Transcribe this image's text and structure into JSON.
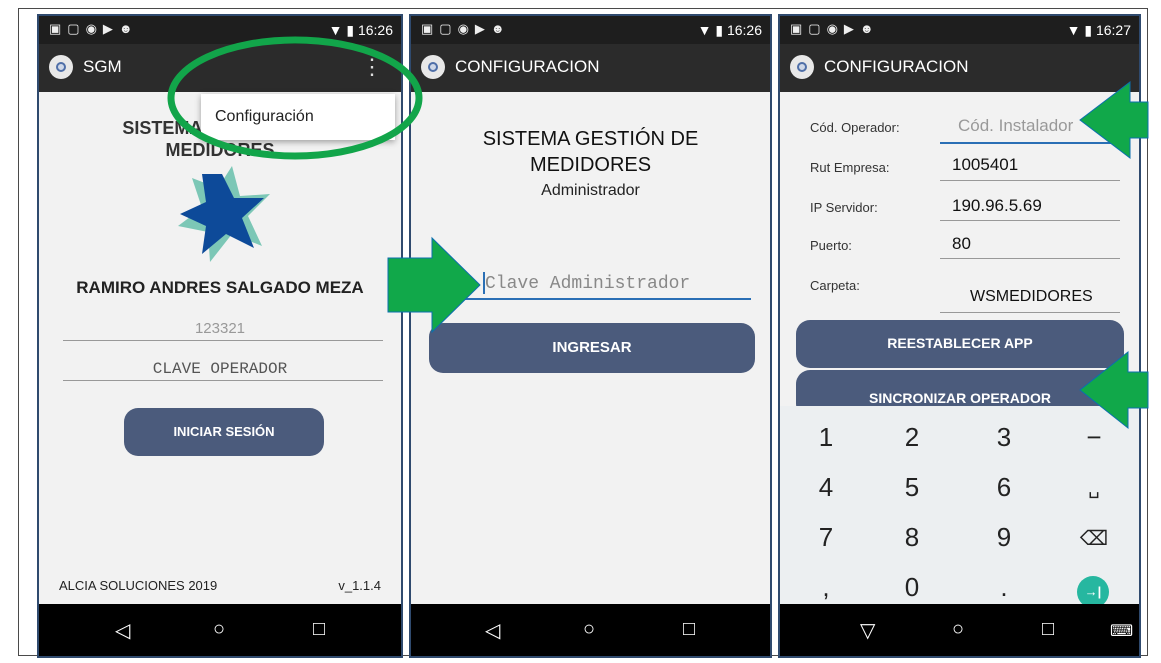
{
  "screen1": {
    "status_time": "16:26",
    "app_title": "SGM",
    "menu_item": "Configuración",
    "title_line1": "SISTEMA GESTIÓN DE",
    "title_line2": "MEDIDORES",
    "user_name": "RAMIRO ANDRES SALGADO MEZA",
    "operator_code": "123321",
    "password_placeholder": "CLAVE OPERADOR",
    "login_button": "INICIAR SESIÓN",
    "footer_company": "ALCIA SOLUCIONES 2019",
    "footer_version": "v_1.1.4"
  },
  "screen2": {
    "status_time": "16:26",
    "app_title": "CONFIGURACION",
    "title_line1": "SISTEMA GESTIÓN DE",
    "title_line2": "MEDIDORES",
    "subtitle": "Administrador",
    "password_placeholder": "Clave Administrador",
    "enter_button": "INGRESAR"
  },
  "screen3": {
    "status_time": "16:27",
    "app_title": "CONFIGURACION",
    "fields": [
      {
        "label": "Cód. Operador:",
        "value": "",
        "placeholder": "Cód. Instalador"
      },
      {
        "label": "Rut Empresa:",
        "value": "1005401"
      },
      {
        "label": "IP Servidor:",
        "value": "190.96.5.69"
      },
      {
        "label": "Puerto:",
        "value": "80"
      },
      {
        "label": "Carpeta:",
        "value": "WSMEDIDORES"
      }
    ],
    "reset_button": "REESTABLECER APP",
    "sync_button": "SINCRONIZAR OPERADOR",
    "keys": [
      "1",
      "2",
      "3",
      "−",
      "4",
      "5",
      "6",
      "␣",
      "7",
      "8",
      "9",
      "⌫",
      ",",
      "0",
      ".",
      "→|"
    ]
  },
  "colors": {
    "button": "#4b5b7c",
    "arrow": "#11a84a",
    "highlight_ellipse": "#12a54a",
    "statusbar": "#1e1e1e",
    "appbar": "#2b2b2b"
  },
  "icons": [
    "back-icon",
    "home-icon",
    "recents-icon",
    "keyboard-icon",
    "overflow-menu-icon",
    "wifi-icon",
    "battery-icon",
    "star-logo-icon"
  ]
}
